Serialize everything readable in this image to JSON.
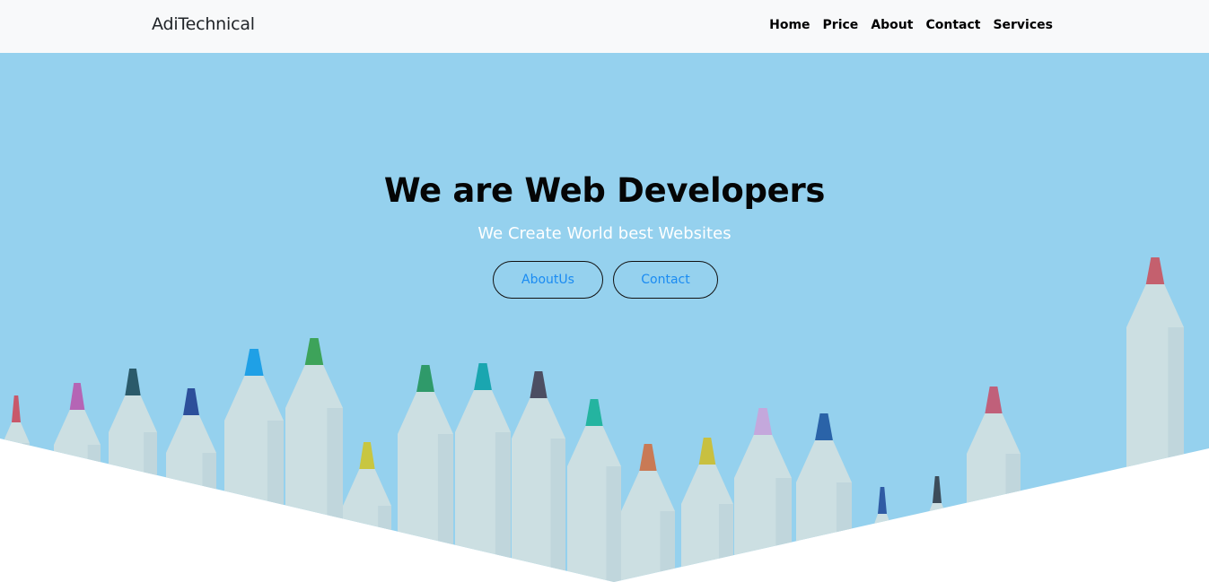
{
  "navbar": {
    "brand": "AdiTechnical",
    "links": [
      "Home",
      "Price",
      "About",
      "Contact",
      "Services"
    ]
  },
  "hero": {
    "title": "We are Web Developers",
    "subtitle": "We Create World best Websites",
    "buttons": [
      "AboutUs",
      "Contact"
    ],
    "background_color": "#95d1ee",
    "button_text_color": "#1a8bf2"
  },
  "pencil_tip_colors": [
    "#c8586a",
    "#b565b5",
    "#2a5a6a",
    "#2c4f9a",
    "#1fa0e6",
    "#3da35a",
    "#c8c640",
    "#2f9a6a",
    "#1aa6b0",
    "#4c4e62",
    "#24b4a0",
    "#c97a55",
    "#c8c040",
    "#c4a8dc",
    "#2a63a8",
    "#2f5ba4",
    "#3c4c5a",
    "#c0607a",
    "#c4606e"
  ]
}
